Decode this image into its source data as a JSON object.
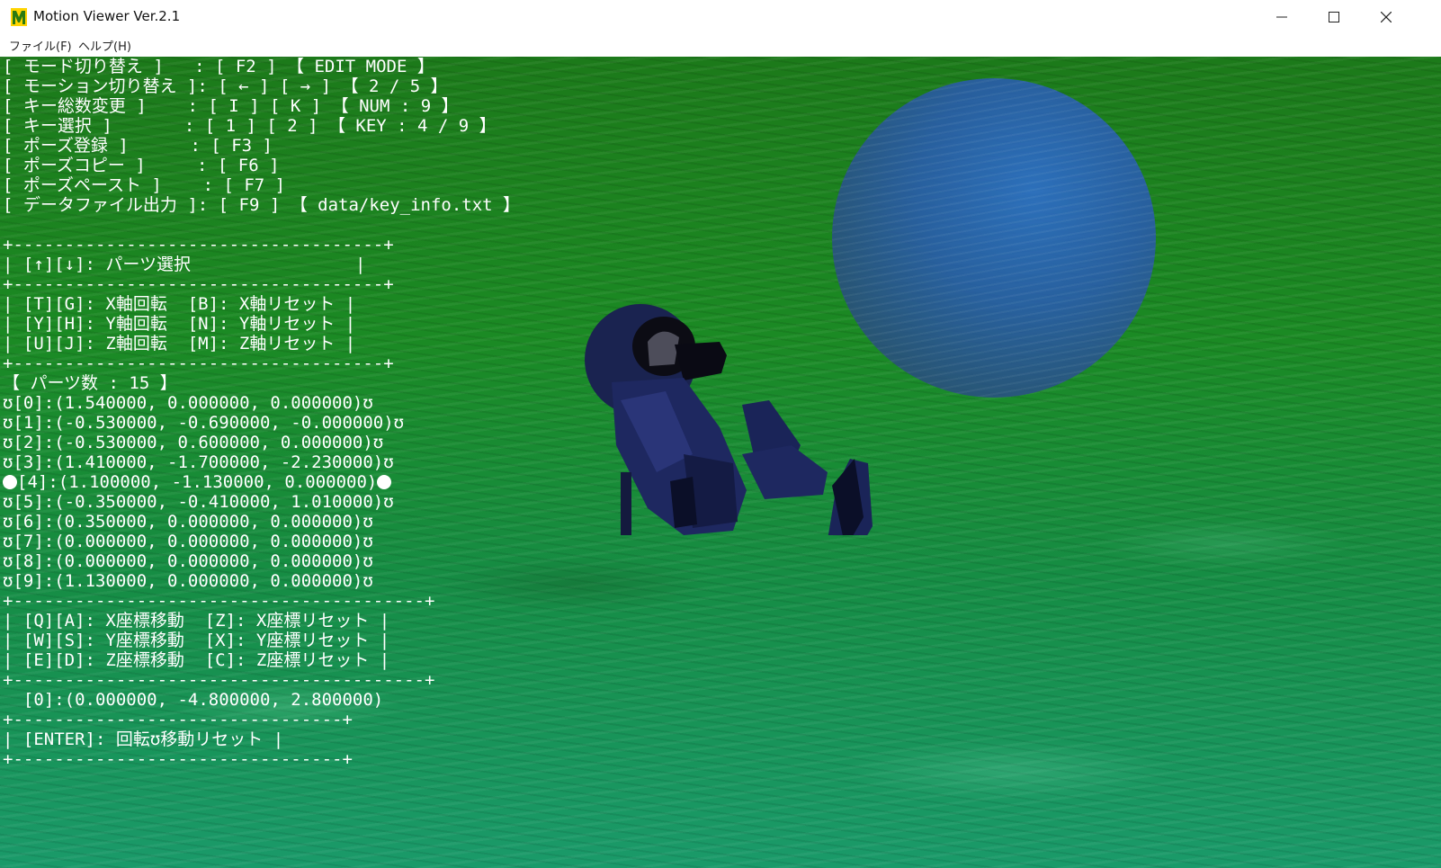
{
  "window": {
    "title": "Motion Viewer Ver.2.1",
    "controls": {
      "minimize": "minimize-icon",
      "maximize": "maximize-icon",
      "close": "close-icon"
    }
  },
  "menubar": {
    "items": [
      {
        "label": "ファイル(F)"
      },
      {
        "label": "ヘルプ(H)"
      }
    ]
  },
  "hud": {
    "lines": [
      "[ モード切り替え ]   : [ F2 ] 【 EDIT MODE 】",
      "[ モーション切り替え ]: [ ← ] [ → ] 【 2 / 5 】",
      "[ キー総数変更 ]    : [ I ] [ K ] 【 NUM : 9 】",
      "[ キー選択 ]       : [ 1 ] [ 2 ] 【 KEY : 4 / 9 】",
      "[ ポーズ登録 ]      : [ F3 ]",
      "[ ポーズコピー ]     : [ F6 ]",
      "[ ポーズペースト ]    : [ F7 ]",
      "[ データファイル出力 ]: [ F9 ] 【 data/key_info.txt 】",
      "",
      "+------------------------------------+",
      "| [↑][↓]: パーツ選択                |",
      "+------------------------------------+",
      "| [T][G]: X軸回転  [B]: X軸リセット |",
      "| [Y][H]: Y軸回転  [N]: Y軸リセット |",
      "| [U][J]: Z軸回転  [M]: Z軸リセット |",
      "+------------------------------------+",
      "【 パーツ数 : 15 】",
      "ʊ[0]:(1.540000, 0.000000, 0.000000)ʊ",
      "ʊ[1]:(-0.530000, -0.690000, -0.000000)ʊ",
      "ʊ[2]:(-0.530000, 0.600000, 0.000000)ʊ",
      "ʊ[3]:(1.410000, -1.700000, -2.230000)ʊ",
      "[4]:(1.100000, -1.130000, 0.000000)",
      "ʊ[5]:(-0.350000, -0.410000, 1.010000)ʊ",
      "ʊ[6]:(0.350000, 0.000000, 0.000000)ʊ",
      "ʊ[7]:(0.000000, 0.000000, 0.000000)ʊ",
      "ʊ[8]:(0.000000, 0.000000, 0.000000)ʊ",
      "ʊ[9]:(1.130000, 0.000000, 0.000000)ʊ",
      "+----------------------------------------+",
      "| [Q][A]: X座標移動  [Z]: X座標リセット |",
      "| [W][S]: Y座標移動  [X]: Y座標リセット |",
      "| [E][D]: Z座標移動  [C]: Z座標リセット |",
      "+----------------------------------------+",
      "  [0]:(0.000000, -4.800000, 2.800000)",
      "+--------------------------------+",
      "| [ENTER]: 回転ʊ移動リセット |",
      "+--------------------------------+"
    ],
    "selected_index": 21
  },
  "scene": {
    "ground_color": "#1b8a24",
    "sphere_color": "#2a5cb0",
    "character_color": "#1a2350"
  }
}
